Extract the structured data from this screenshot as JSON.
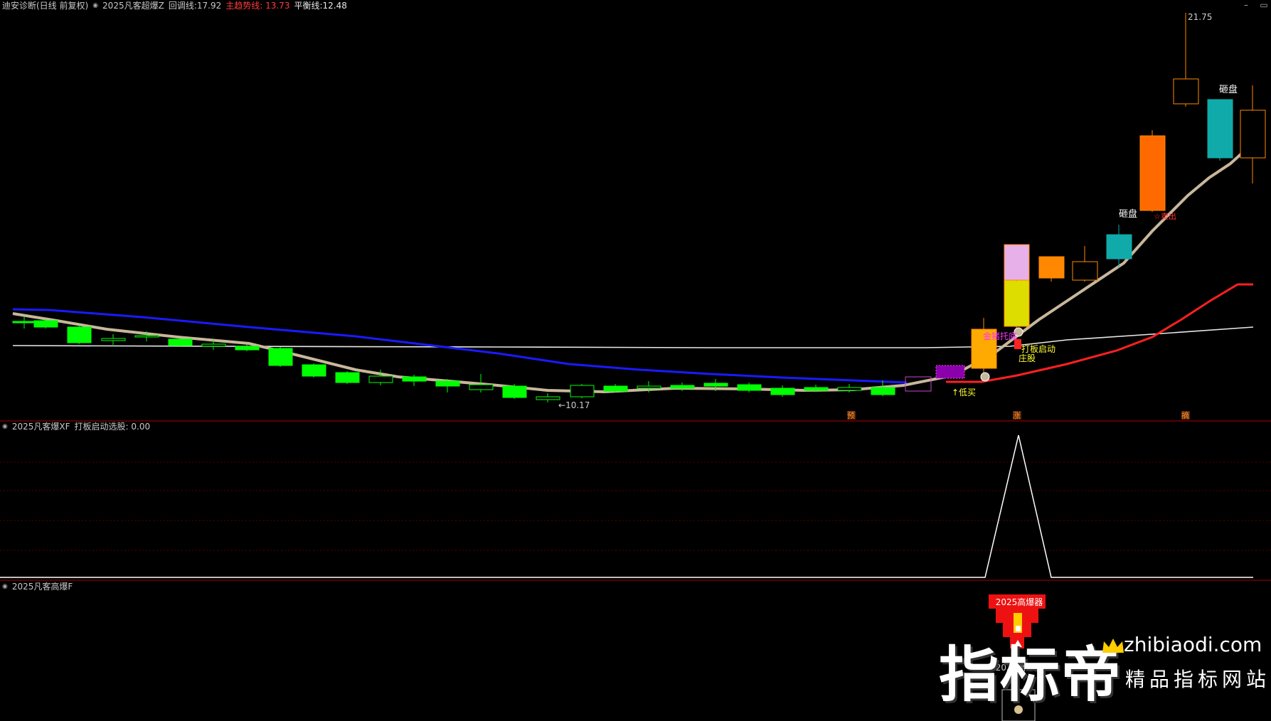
{
  "main_panel": {
    "stock_name": "迪安诊断(日线 前复权)",
    "indicator_name": "2025凡客超爆Z",
    "lines": [
      {
        "label": "回调线:",
        "value": "17.92",
        "color": "#c8c8c8"
      },
      {
        "label": "主趋势线:",
        "value": "13.73",
        "color": "#ff3b3b"
      },
      {
        "label": "平衡线:",
        "value": "12.48",
        "color": "#e8e8e8"
      }
    ],
    "high_label": "21.75",
    "low_label": "10.17",
    "signals": {
      "zapan_1": "砸盘",
      "zapan_2": "砸盘",
      "jinzhu": "金猪托底",
      "daban": "打板启动",
      "zhuanggu": "庄股",
      "dimai": "↑低买",
      "qiangyou": "☆卖出"
    },
    "markers": [
      "预",
      "涨",
      "摘"
    ]
  },
  "sub_panel_1": {
    "indicator_name": "2025凡客爆XF",
    "line_label": "打板启动选股:",
    "line_value": "0.00"
  },
  "sub_panel_2": {
    "indicator_name": "2025凡客高爆F",
    "banner_top": "2025高爆器",
    "banner_bottom": "2025高爆器"
  },
  "watermark": {
    "brand_cn": "指标帝",
    "domain": "zhibiaodi.com",
    "slogan": "精品指标网站"
  },
  "colors": {
    "background": "#000000",
    "up_candle": "#ff6a00",
    "down_candle": "#00ff00",
    "ma_blue": "#1a1aff",
    "ma_tan": "#c8b79a",
    "ma_red": "#ff2020",
    "balance_line": "#e8e8e8",
    "divider": "#b00000"
  }
}
